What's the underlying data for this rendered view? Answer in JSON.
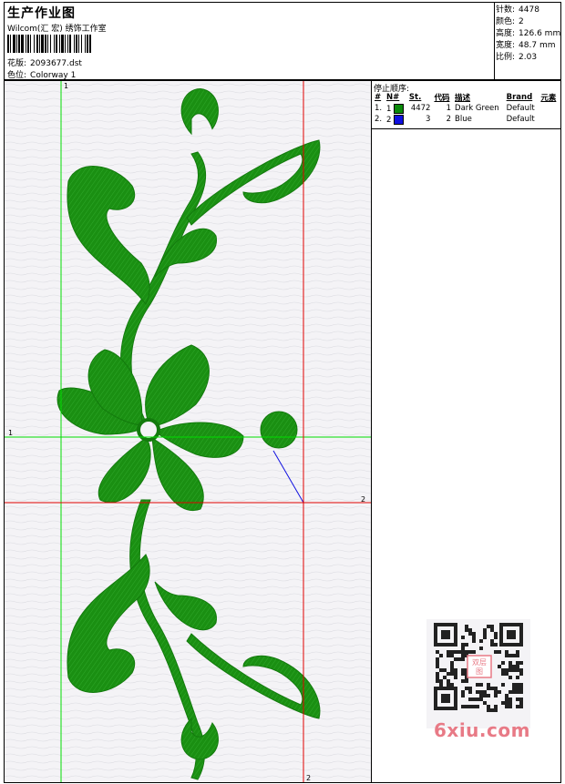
{
  "header": {
    "title": "生产作业图",
    "subtitle": "Wilcom(汇 宏) 绣饰工作室",
    "design_label": "花版:",
    "design_value": "2093677.dst",
    "colorway_label": "色位:",
    "colorway_value": "Colorway 1"
  },
  "stats": [
    {
      "label": "针数:",
      "value": "4478"
    },
    {
      "label": "颜色:",
      "value": "2"
    },
    {
      "label": "高度:",
      "value": "126.6 mm"
    },
    {
      "label": "宽度:",
      "value": "48.7 mm"
    },
    {
      "label": "比例:",
      "value": "2.03"
    }
  ],
  "stop_sequence": {
    "heading": "停止顺序:",
    "columns": [
      "#",
      "N#",
      "St.",
      "代码",
      "描述",
      "Brand",
      "元素"
    ],
    "rows": [
      {
        "idx": "1.",
        "n": "1",
        "color": "#0a8a0a",
        "stitches": "4472",
        "code": "1",
        "description": "Dark Green",
        "brand": "Default"
      },
      {
        "idx": "2.",
        "n": "2",
        "color": "#1010e0",
        "stitches": "3",
        "code": "2",
        "description": "Blue",
        "brand": "Default"
      }
    ]
  },
  "guides": {
    "green_label_top": "1",
    "green_label_left": "1",
    "red_label_right": "2",
    "red_label_bottom": "2"
  },
  "colors": {
    "embroidery": "#1a8f12",
    "guide_green": "#00dd00",
    "guide_red": "#e00000",
    "background": "#f4f3f6",
    "watermark": "#e87a86"
  },
  "watermark": "6xiu.com",
  "qr_center_text": "双层\n图"
}
